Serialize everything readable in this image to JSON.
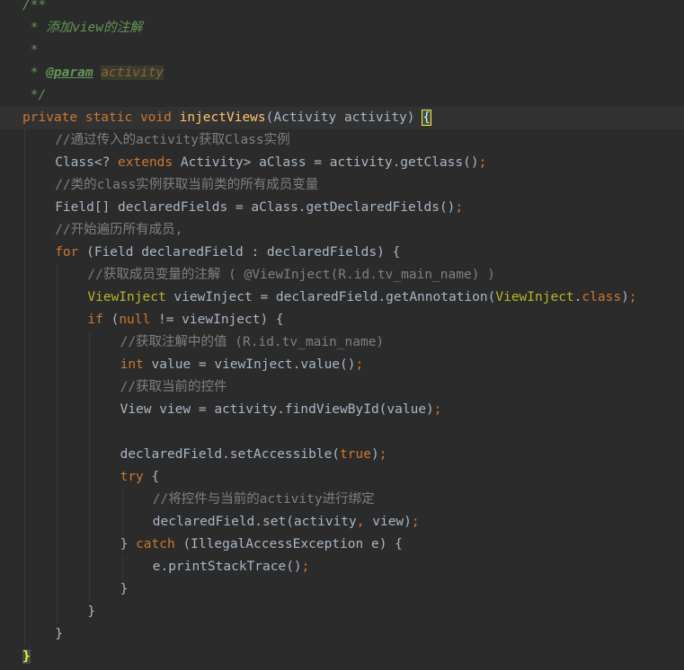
{
  "theme": {
    "background": "#2b2b2b",
    "default_text": "#a9b7c6",
    "keyword": "#cc7832",
    "method_declaration": "#ffc66d",
    "comment": "#808080",
    "doc_comment": "#629755",
    "annotation": "#bbb529"
  },
  "code_lines": [
    {
      "indent": 0,
      "tokens": [
        {
          "t": "/**",
          "k": "dc"
        }
      ]
    },
    {
      "indent": 0,
      "tokens": [
        {
          "t": " * 添加view的注解",
          "k": "dc"
        }
      ]
    },
    {
      "indent": 0,
      "tokens": [
        {
          "t": " *",
          "k": "dc"
        }
      ]
    },
    {
      "indent": 0,
      "tokens": [
        {
          "t": " * ",
          "k": "dc"
        },
        {
          "t": "@param",
          "k": "dtag"
        },
        {
          "t": " ",
          "k": "dc"
        },
        {
          "t": "activity",
          "k": "dparam"
        }
      ]
    },
    {
      "indent": 0,
      "tokens": [
        {
          "t": " */",
          "k": "dc"
        }
      ]
    },
    {
      "indent": 0,
      "caret": true,
      "tokens": [
        {
          "t": "private static void ",
          "k": "kw"
        },
        {
          "t": "injectViews",
          "k": "fn"
        },
        {
          "t": "(Activity activity) ",
          "k": "p"
        },
        {
          "t": "{",
          "k": "br"
        }
      ]
    },
    {
      "indent": 1,
      "tokens": [
        {
          "t": "//通过传入的activity获取Class实例",
          "k": "cm"
        }
      ]
    },
    {
      "indent": 1,
      "tokens": [
        {
          "t": "Class<? ",
          "k": "p"
        },
        {
          "t": "extends",
          "k": "kw"
        },
        {
          "t": " Activity> aClass = activity.getClass()",
          "k": "p"
        },
        {
          "t": ";",
          "k": "kw"
        }
      ]
    },
    {
      "indent": 1,
      "tokens": [
        {
          "t": "//类的class实例获取当前类的所有成员变量",
          "k": "cm"
        }
      ]
    },
    {
      "indent": 1,
      "tokens": [
        {
          "t": "Field[] declaredFields = aClass.getDeclaredFields()",
          "k": "p"
        },
        {
          "t": ";",
          "k": "kw"
        }
      ]
    },
    {
      "indent": 1,
      "tokens": [
        {
          "t": "//开始遍历所有成员,",
          "k": "cm"
        }
      ]
    },
    {
      "indent": 1,
      "tokens": [
        {
          "t": "for",
          "k": "kw"
        },
        {
          "t": " (Field declaredField : declaredFields) {",
          "k": "p"
        }
      ]
    },
    {
      "indent": 2,
      "tokens": [
        {
          "t": "//获取成员变量的注解 ( @ViewInject(R.id.tv_main_name) )",
          "k": "cm"
        }
      ]
    },
    {
      "indent": 2,
      "tokens": [
        {
          "t": "ViewInject",
          "k": "an"
        },
        {
          "t": " viewInject = declaredField.getAnnotation(",
          "k": "p"
        },
        {
          "t": "ViewInject",
          "k": "an"
        },
        {
          "t": ".",
          "k": "p"
        },
        {
          "t": "class",
          "k": "kw"
        },
        {
          "t": ")",
          "k": "p"
        },
        {
          "t": ";",
          "k": "kw"
        }
      ]
    },
    {
      "indent": 2,
      "tokens": [
        {
          "t": "if",
          "k": "kw"
        },
        {
          "t": " (",
          "k": "p"
        },
        {
          "t": "null",
          "k": "kw"
        },
        {
          "t": " != viewInject) {",
          "k": "p"
        }
      ]
    },
    {
      "indent": 3,
      "tokens": [
        {
          "t": "//获取注解中的值 (R.id.tv_main_name)",
          "k": "cm"
        }
      ]
    },
    {
      "indent": 3,
      "tokens": [
        {
          "t": "int",
          "k": "kw"
        },
        {
          "t": " value = viewInject.value()",
          "k": "p"
        },
        {
          "t": ";",
          "k": "kw"
        }
      ]
    },
    {
      "indent": 3,
      "tokens": [
        {
          "t": "//获取当前的控件",
          "k": "cm"
        }
      ]
    },
    {
      "indent": 3,
      "tokens": [
        {
          "t": "View view = activity.findViewById(value)",
          "k": "p"
        },
        {
          "t": ";",
          "k": "kw"
        }
      ]
    },
    {
      "indent": 3,
      "tokens": []
    },
    {
      "indent": 3,
      "tokens": [
        {
          "t": "declaredField.setAccessible(",
          "k": "p"
        },
        {
          "t": "true",
          "k": "kw"
        },
        {
          "t": ")",
          "k": "p"
        },
        {
          "t": ";",
          "k": "kw"
        }
      ]
    },
    {
      "indent": 3,
      "tokens": [
        {
          "t": "try",
          "k": "kw"
        },
        {
          "t": " {",
          "k": "p"
        }
      ]
    },
    {
      "indent": 4,
      "tokens": [
        {
          "t": "//将控件与当前的activity进行绑定",
          "k": "cm"
        }
      ]
    },
    {
      "indent": 4,
      "tokens": [
        {
          "t": "declaredField.set(activity",
          "k": "p"
        },
        {
          "t": ",",
          "k": "kw"
        },
        {
          "t": " view)",
          "k": "p"
        },
        {
          "t": ";",
          "k": "kw"
        }
      ]
    },
    {
      "indent": 3,
      "tokens": [
        {
          "t": "} ",
          "k": "p"
        },
        {
          "t": "catch",
          "k": "kw"
        },
        {
          "t": " (IllegalAccessException e) {",
          "k": "p"
        }
      ]
    },
    {
      "indent": 4,
      "tokens": [
        {
          "t": "e.printStackTrace()",
          "k": "p"
        },
        {
          "t": ";",
          "k": "kw"
        }
      ]
    },
    {
      "indent": 3,
      "tokens": [
        {
          "t": "}",
          "k": "p"
        }
      ]
    },
    {
      "indent": 2,
      "tokens": [
        {
          "t": "}",
          "k": "p"
        }
      ]
    },
    {
      "indent": 1,
      "tokens": [
        {
          "t": "}",
          "k": "p"
        }
      ]
    },
    {
      "indent": 0,
      "tokens": [
        {
          "t": "}",
          "k": "cb"
        }
      ]
    }
  ]
}
